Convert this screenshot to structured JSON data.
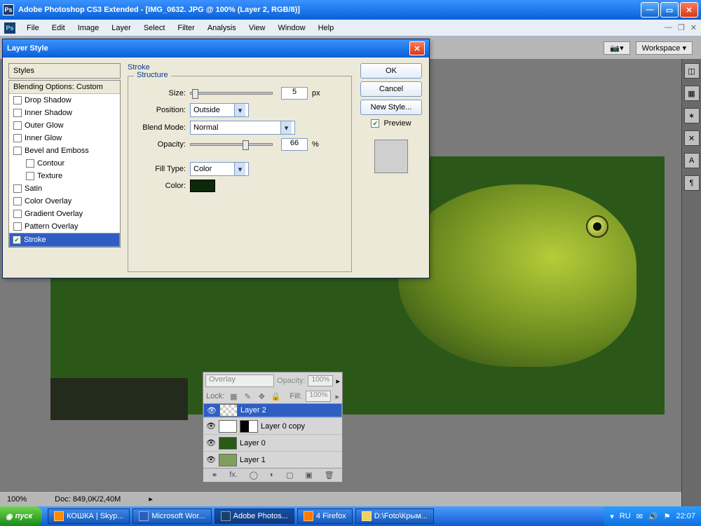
{
  "titlebar": {
    "app": "Adobe Photoshop CS3 Extended",
    "doc": "[IMG_0632. JPG @ 100% (Layer 2, RGB/8)]"
  },
  "menus": [
    "File",
    "Edit",
    "Image",
    "Layer",
    "Select",
    "Filter",
    "Analysis",
    "View",
    "Window",
    "Help"
  ],
  "optbar": {
    "workspace": "Workspace ▾"
  },
  "dialog": {
    "title": "Layer Style",
    "styles_header": "Styles",
    "blend_header": "Blending Options: Custom",
    "effects": [
      {
        "label": "Drop Shadow",
        "on": false
      },
      {
        "label": "Inner Shadow",
        "on": false
      },
      {
        "label": "Outer Glow",
        "on": false
      },
      {
        "label": "Inner Glow",
        "on": false
      },
      {
        "label": "Bevel and Emboss",
        "on": false
      },
      {
        "label": "Contour",
        "on": false,
        "indent": true
      },
      {
        "label": "Texture",
        "on": false,
        "indent": true
      },
      {
        "label": "Satin",
        "on": false
      },
      {
        "label": "Color Overlay",
        "on": false
      },
      {
        "label": "Gradient Overlay",
        "on": false
      },
      {
        "label": "Pattern Overlay",
        "on": false
      },
      {
        "label": "Stroke",
        "on": true,
        "sel": true
      }
    ],
    "panel_title": "Stroke",
    "structure_label": "Structure",
    "size_label": "Size:",
    "size_val": "5",
    "size_unit": "px",
    "position_label": "Position:",
    "position_val": "Outside",
    "blendmode_label": "Blend Mode:",
    "blendmode_val": "Normal",
    "opacity_label": "Opacity:",
    "opacity_val": "66",
    "opacity_unit": "%",
    "filltype_label": "Fill Type:",
    "filltype_val": "Color",
    "color_label": "Color:",
    "color_val": "#0b2a0b",
    "buttons": {
      "ok": "OK",
      "cancel": "Cancel",
      "newstyle": "New Style...",
      "preview": "Preview"
    }
  },
  "layers": {
    "mode": "Overlay",
    "opacity_label": "Opacity:",
    "opacity_val": "100%",
    "lock_label": "Lock:",
    "fill_label": "Fill:",
    "fill_val": "100%",
    "items": [
      {
        "name": "Layer 2",
        "sel": true,
        "thumb": "checker"
      },
      {
        "name": "Layer 0 copy",
        "sel": false,
        "thumb": "mask"
      },
      {
        "name": "Layer 0",
        "sel": false,
        "thumb": "green"
      },
      {
        "name": "Layer 1",
        "sel": false,
        "thumb": "lime"
      }
    ]
  },
  "status": {
    "zoom": "100%",
    "doc": "Doc: 849,0K/2,40M"
  },
  "taskbar": {
    "start": "пуск",
    "tasks": [
      {
        "label": "КОШКА | Skyp...",
        "color": "#ff8a00"
      },
      {
        "label": "Microsoft Wor...",
        "color": "#2a5cc0"
      },
      {
        "label": "Adobe Photos...",
        "color": "#18406a",
        "active": true
      },
      {
        "label": "4 Firefox",
        "color": "#ff7a00"
      },
      {
        "label": "D:\\Foto\\Крым...",
        "color": "#f0d060"
      }
    ],
    "lang": "RU",
    "time": "22:07"
  }
}
